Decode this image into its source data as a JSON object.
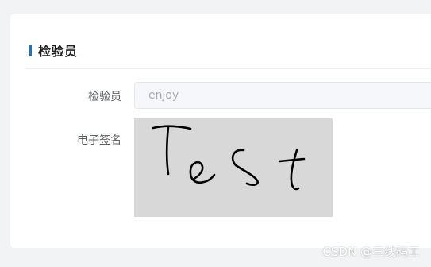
{
  "section": {
    "title": "检验员",
    "accent_color": "#1a73c9"
  },
  "form": {
    "inspector_label": "检验员",
    "inspector_value": "enjoy",
    "signature_label": "电子签名",
    "signature_text": "Test"
  },
  "watermark": "CSDN @三线码工"
}
